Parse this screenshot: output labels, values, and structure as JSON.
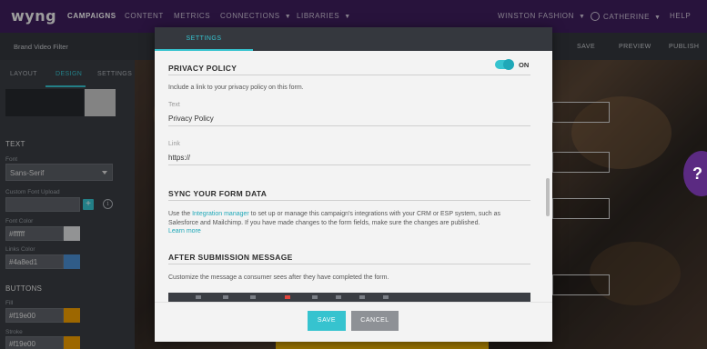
{
  "topnav": {
    "logo": "wyng",
    "items": [
      "CAMPAIGNS",
      "CONTENT",
      "METRICS",
      "CONNECTIONS",
      "LIBRARIES"
    ],
    "account": "WINSTON FASHION",
    "user": "CATHERINE",
    "help": "HELP"
  },
  "subbar": {
    "title": "Brand Video Filter",
    "save": "SAVE",
    "preview": "PREVIEW",
    "publish": "PUBLISH"
  },
  "leftpanel": {
    "tabs": [
      "LAYOUT",
      "DESIGN",
      "SETTINGS"
    ],
    "text_heading": "TEXT",
    "font_label": "Font",
    "font_value": "Sans-Serif",
    "custom_font_label": "Custom Font Upload",
    "font_color_label": "Font Color",
    "font_color_value": "#ffffff",
    "links_color_label": "Links Color",
    "links_color_value": "#4a8ed1",
    "buttons_heading": "BUTTONS",
    "fill_label": "Fill",
    "fill_value": "#f19e00",
    "stroke_label": "Stroke",
    "stroke_value": "#f19e00"
  },
  "colors": {
    "accent": "#36c3cf",
    "nav_bg": "#3e1e5c",
    "font_color": "#ffffff",
    "links_color": "#4a8ed1",
    "fill_color": "#f19e00",
    "stroke_color": "#f19e00"
  },
  "modal": {
    "tab": "SETTINGS",
    "privacy": {
      "heading": "PRIVACY POLICY",
      "toggle_label": "ON",
      "description": "Include a link to your privacy policy on this form.",
      "text_label": "Text",
      "text_value": "Privacy Policy",
      "link_label": "Link",
      "link_value": "https://"
    },
    "sync": {
      "heading": "SYNC YOUR FORM DATA",
      "text_before": "Use the ",
      "link_text": "Integration manager",
      "text_after": " to set up or manage this campaign's integrations with your CRM or ESP system, such as Salesforce and Mailchimp. If you have made changes to the form fields, make sure the changes are published.",
      "learn_more": "Learn more"
    },
    "after": {
      "heading": "AFTER SUBMISSION MESSAGE",
      "description": "Customize the message a consumer sees after they have completed the form."
    },
    "save_label": "SAVE",
    "cancel_label": "CANCEL"
  },
  "help_glyph": "?"
}
